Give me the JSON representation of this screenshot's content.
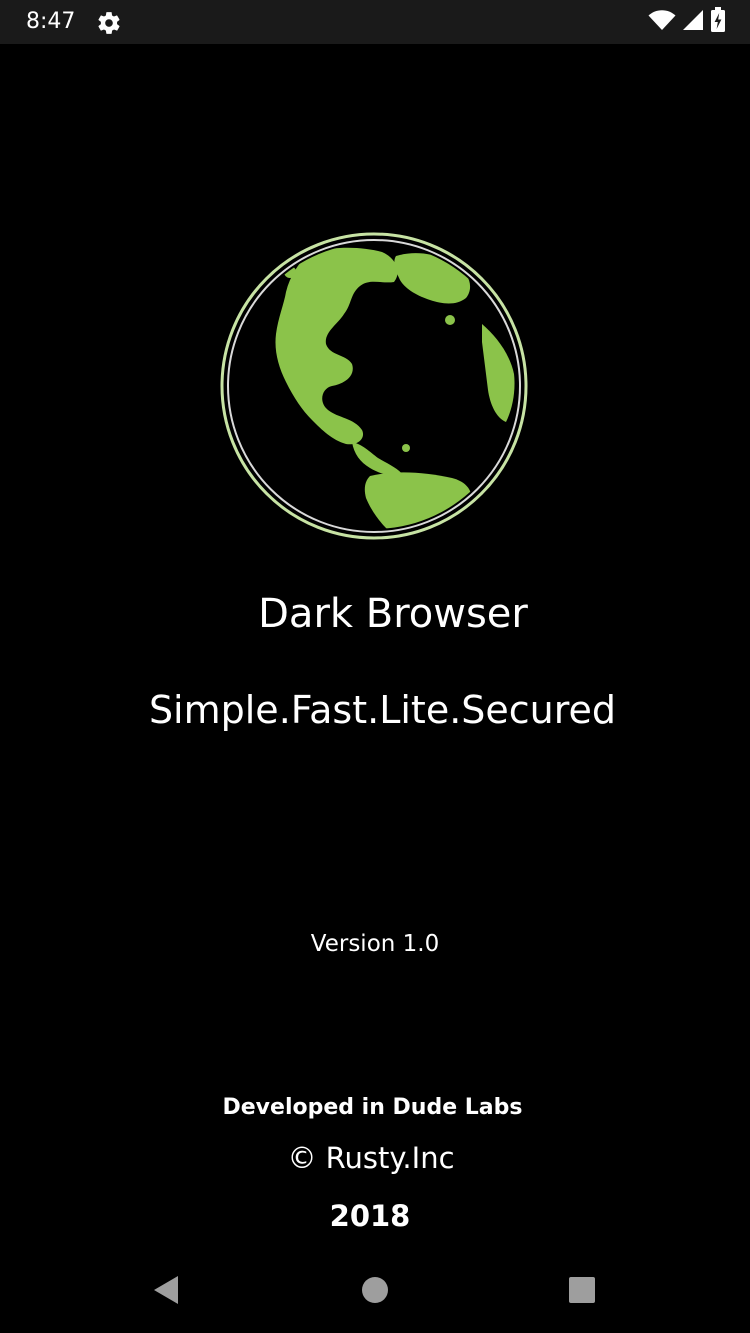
{
  "status_bar": {
    "time": "8:47",
    "icons": [
      "settings-gear-icon",
      "wifi-icon",
      "cellular-signal-icon",
      "battery-icon"
    ]
  },
  "app": {
    "title": "Dark Browser",
    "tagline": "Simple.Fast.Lite.Secured",
    "version": "Version 1.0",
    "developer": "Developed in Dude Labs",
    "copyright": "© Rusty.Inc",
    "year": "2018",
    "logo": "globe-icon"
  },
  "nav_bar": {
    "buttons": [
      "back-icon",
      "home-icon",
      "recents-icon"
    ]
  },
  "colors": {
    "background": "#000000",
    "status_bar": "#1a1a1a",
    "globe_land": "#8bc34a",
    "text": "#ffffff",
    "nav_icons": "#9e9e9e"
  }
}
